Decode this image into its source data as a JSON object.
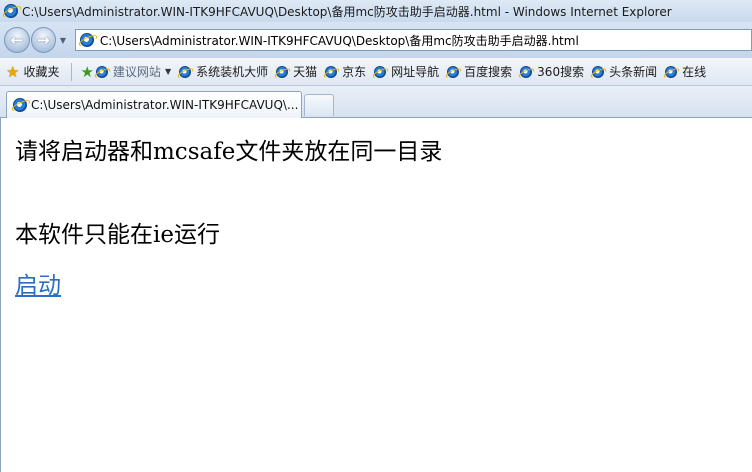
{
  "window": {
    "title": "C:\\Users\\Administrator.WIN-ITK9HFCAVUQ\\Desktop\\备用mc防攻击助手启动器.html - Windows Internet Explorer",
    "back_icon": "back-arrow-icon",
    "forward_icon": "forward-arrow-icon"
  },
  "address": {
    "url": "C:\\Users\\Administrator.WIN-ITK9HFCAVUQ\\Desktop\\备用mc防攻击助手启动器.html"
  },
  "favorites": {
    "label": "收藏夹",
    "items": [
      {
        "label": "建议网站"
      },
      {
        "label": "系统装机大师"
      },
      {
        "label": "天猫"
      },
      {
        "label": "京东"
      },
      {
        "label": "网址导航"
      },
      {
        "label": "百度搜索"
      },
      {
        "label": "360搜索"
      },
      {
        "label": "头条新闻"
      },
      {
        "label": "在线"
      }
    ]
  },
  "tabs": [
    {
      "label": "C:\\Users\\Administrator.WIN-ITK9HFCAVUQ\\..."
    }
  ],
  "content": {
    "line1": "请将启动器和mcsafe文件夹放在同一目录",
    "line2": "本软件只能在ie运行",
    "link": "启动"
  },
  "colors": {
    "link": "#2a6fbf",
    "chrome": "#c9daee"
  }
}
